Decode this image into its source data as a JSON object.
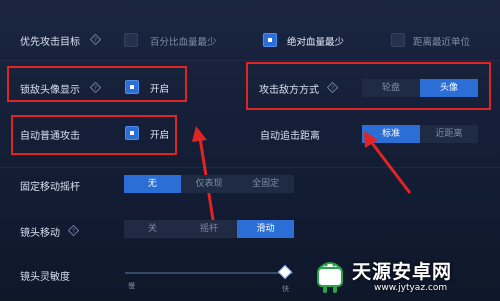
{
  "rows": {
    "priority": {
      "label": "优先攻击目标",
      "options": [
        {
          "label": "百分比血量最少",
          "checked": false
        },
        {
          "label": "绝对血量最少",
          "checked": true
        },
        {
          "label": "距离最近单位",
          "checked": false
        }
      ]
    },
    "lock_avatar": {
      "label": "锁敌头像显示",
      "toggle": "开启",
      "checked": true
    },
    "attack_mode": {
      "label": "攻击敌方方式",
      "options": [
        "轮盘",
        "头像"
      ],
      "selected": "头像"
    },
    "auto_attack": {
      "label": "自动普通攻击",
      "toggle": "开启",
      "checked": true
    },
    "chase": {
      "label": "自动追击距离",
      "options": [
        "标准",
        "近距离"
      ],
      "selected": "标准"
    },
    "joystick": {
      "label": "固定移动摇杆",
      "options": [
        "无",
        "仅表现",
        "全固定"
      ],
      "selected": "无"
    },
    "camera_move": {
      "label": "镜头移动",
      "options": [
        "关",
        "摇杆",
        "滑动"
      ],
      "selected": "滑动"
    },
    "sensitivity": {
      "label": "镜头灵敏度",
      "min_label": "慢",
      "max_label": "快",
      "value_fraction": 0.95
    }
  },
  "watermark": {
    "brand": "天源安卓网",
    "url": "www.jytyaz.com"
  },
  "colors": {
    "accent": "#2b6fd6",
    "highlight": "#e02424",
    "background": "#141e36"
  },
  "icons": {
    "help": "question-diamond-icon",
    "logo": "android-robot-icon"
  }
}
